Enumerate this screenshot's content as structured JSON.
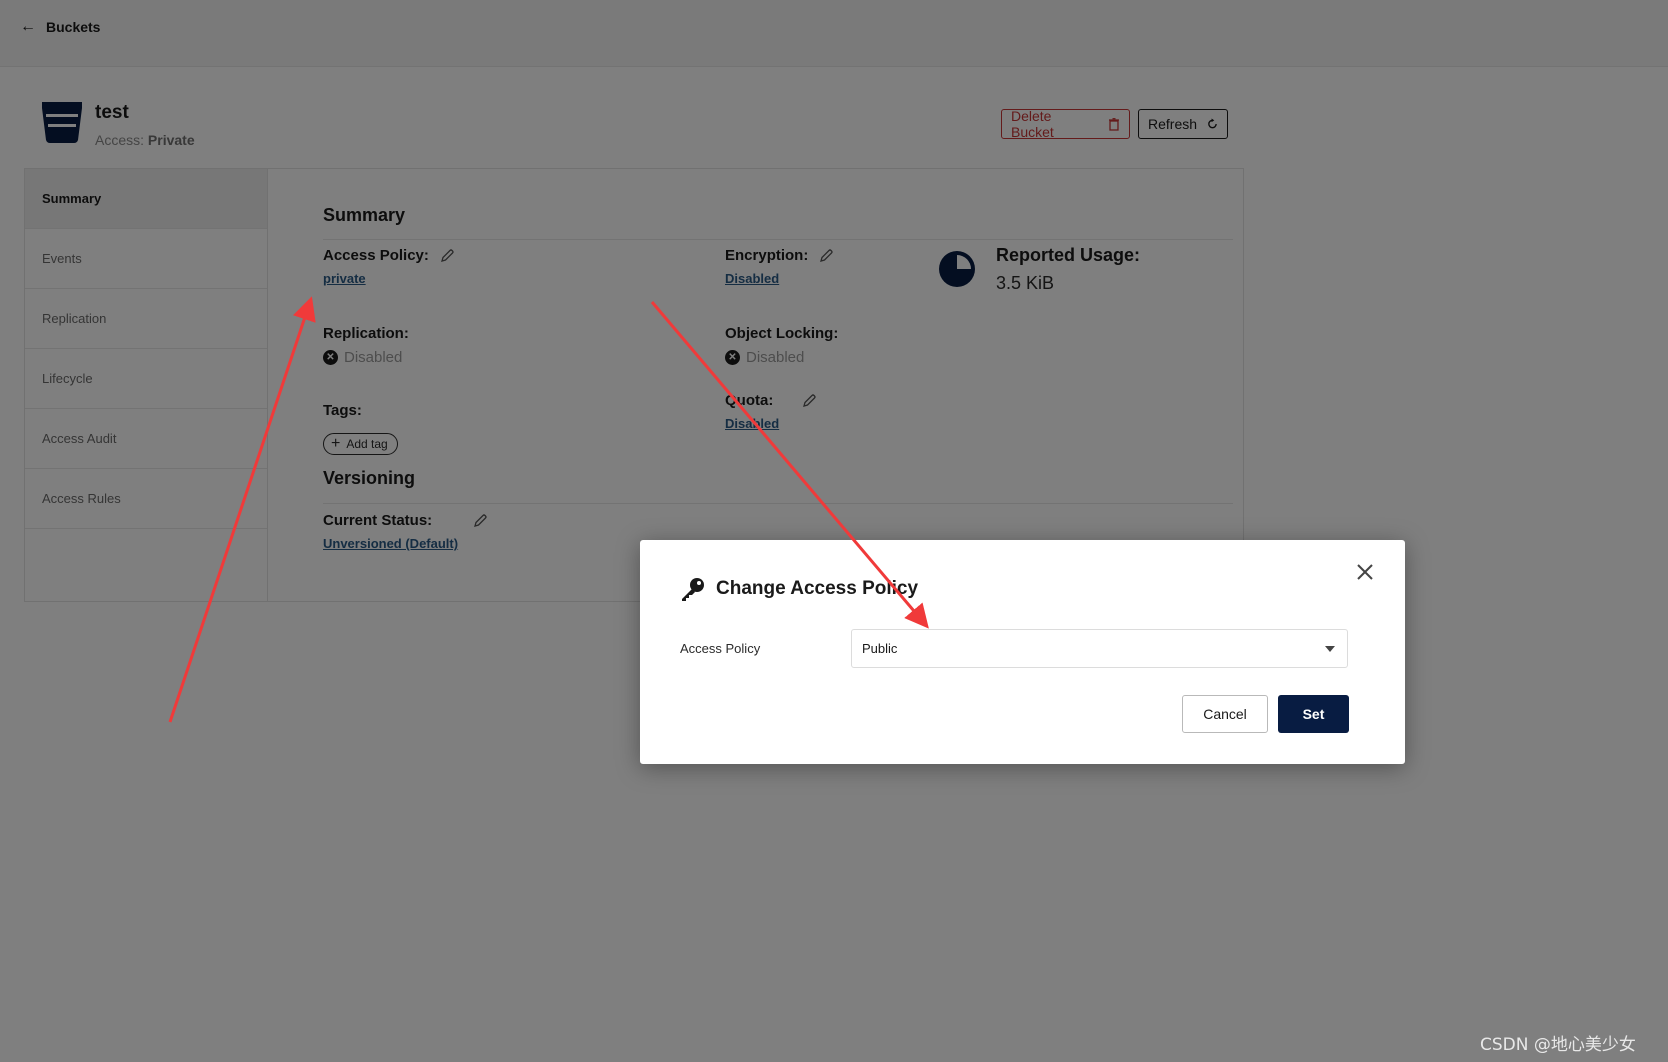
{
  "topbar": {
    "back_label": "Buckets"
  },
  "bucket": {
    "name": "test",
    "access_prefix": "Access: ",
    "access_value": "Private"
  },
  "actions": {
    "delete_label": "Delete Bucket",
    "refresh_label": "Refresh"
  },
  "sidebar": {
    "items": [
      {
        "label": "Summary",
        "active": true
      },
      {
        "label": "Events"
      },
      {
        "label": "Replication"
      },
      {
        "label": "Lifecycle"
      },
      {
        "label": "Access Audit"
      },
      {
        "label": "Access Rules"
      }
    ]
  },
  "summary": {
    "title": "Summary",
    "access_policy": {
      "label": "Access Policy:",
      "value": "private"
    },
    "encryption": {
      "label": "Encryption:",
      "value": "Disabled"
    },
    "reported_usage": {
      "label": "Reported Usage:",
      "value": "3.5 KiB"
    },
    "replication": {
      "label": "Replication:",
      "value": "Disabled"
    },
    "object_locking": {
      "label": "Object Locking:",
      "value": "Disabled"
    },
    "tags": {
      "label": "Tags:",
      "add_label": "Add tag"
    },
    "quota": {
      "label": "Quota:",
      "value": "Disabled"
    }
  },
  "versioning": {
    "title": "Versioning",
    "status_label": "Current Status:",
    "status_value": "Unversioned (Default)"
  },
  "modal": {
    "title": "Change Access Policy",
    "field_label": "Access Policy",
    "selected": "Public",
    "cancel_label": "Cancel",
    "set_label": "Set"
  },
  "colors": {
    "accent_dark": "#081c42",
    "danger": "#c83737",
    "link": "#2b5b86",
    "annotation": "#f03a3a"
  },
  "watermark": "CSDN @地心美少女"
}
